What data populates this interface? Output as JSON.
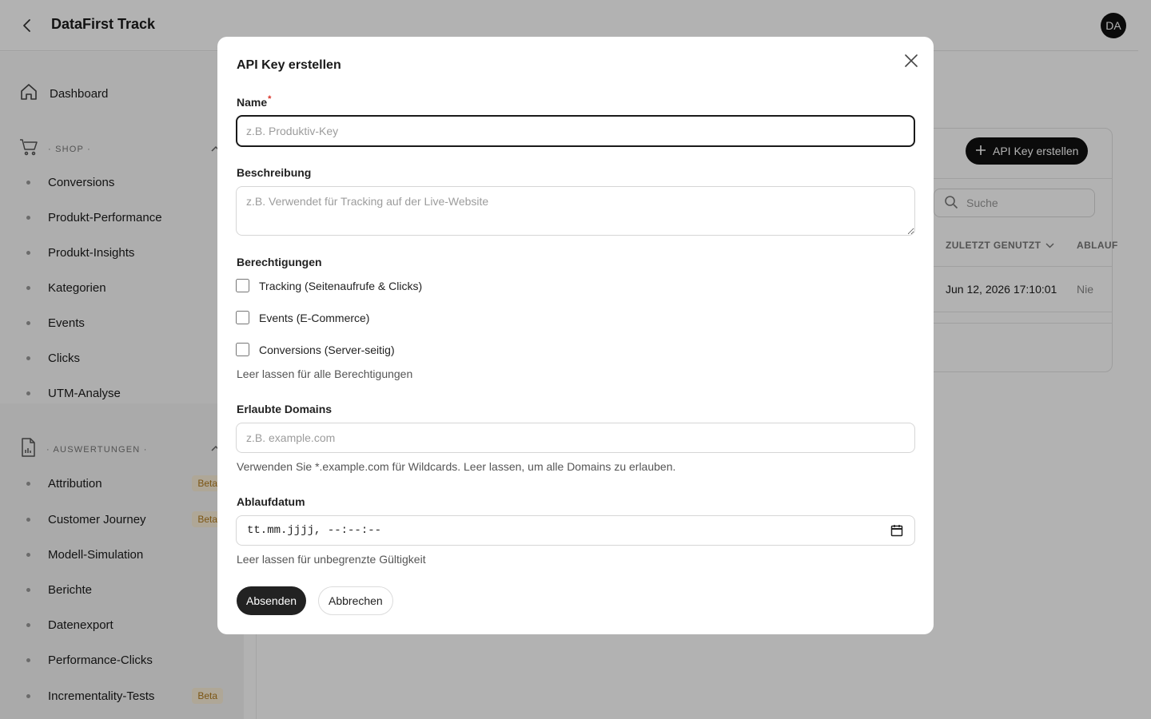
{
  "app": {
    "title": "DataFirst Track",
    "avatar_initials": "DA"
  },
  "sidebar": {
    "dashboard": "Dashboard",
    "sections": [
      {
        "label": "· SHOP ·",
        "items": [
          "Conversions",
          "Produkt-Performance",
          "Produkt-Insights",
          "Kategorien",
          "Events",
          "Clicks",
          "UTM-Analyse"
        ]
      },
      {
        "label": "· AUSWERTUNGEN ·",
        "items": [
          "Attribution",
          "Customer Journey",
          "Modell-Simulation",
          "Berichte",
          "Datenexport",
          "Performance-Clicks",
          "Incrementality-Tests"
        ]
      }
    ],
    "badges": {
      "attribution": "Beta",
      "customer_journey": "Beta",
      "incrementality": "Beta"
    }
  },
  "page": {
    "create_button": "API Key erstellen",
    "search_placeholder": "Suche",
    "columns": {
      "last_used": "ZULETZT GENUTZT",
      "expires": "ABLAUF"
    },
    "row": {
      "last_used": "Jun 12, 2026 17:10:01",
      "expires": "Nie"
    }
  },
  "modal": {
    "title": "API Key erstellen",
    "name": {
      "label": "Name",
      "required_mark": "*",
      "placeholder": "z.B. Produktiv-Key"
    },
    "description": {
      "label": "Beschreibung",
      "placeholder": "z.B. Verwendet für Tracking auf der Live-Website"
    },
    "permissions": {
      "label": "Berechtigungen",
      "options": [
        "Tracking (Seitenaufrufe & Clicks)",
        "Events (E-Commerce)",
        "Conversions (Server-seitig)"
      ],
      "checked": [
        false,
        false,
        false
      ],
      "helper": "Leer lassen für alle Berechtigungen"
    },
    "domains": {
      "label": "Erlaubte Domains",
      "placeholder": "z.B. example.com",
      "helper": "Verwenden Sie *.example.com für Wildcards. Leer lassen, um alle Domains zu erlauben."
    },
    "expiry": {
      "label": "Ablaufdatum",
      "value": "tt.mm.jjjj, --:--:--",
      "helper": "Leer lassen für unbegrenzte Gültigkeit"
    },
    "submit": "Absenden",
    "cancel": "Abbrechen"
  }
}
